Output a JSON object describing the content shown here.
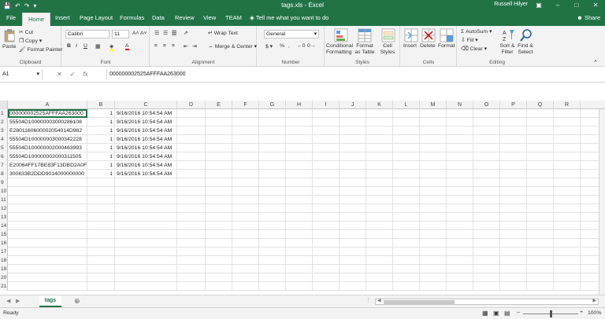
{
  "window": {
    "title": "tags.xls - Excel",
    "user": "Russell Hilyer"
  },
  "tabs": [
    "File",
    "Home",
    "Insert",
    "Page Layout",
    "Formulas",
    "Data",
    "Review",
    "View",
    "TEAM"
  ],
  "tell_me": "Tell me what you want to do",
  "share_label": "Share",
  "ribbon": {
    "clipboard": {
      "paste": "Paste",
      "cut": "Cut",
      "copy": "Copy",
      "format_painter": "Format Painter",
      "label": "Clipboard"
    },
    "font": {
      "name": "Calibri",
      "size": "11",
      "label": "Font"
    },
    "alignment": {
      "wrap_text": "Wrap Text",
      "merge_center": "Merge & Center",
      "label": "Alignment"
    },
    "number": {
      "format": "General",
      "label": "Number"
    },
    "styles": {
      "conditional": "Conditional Formatting",
      "format_table": "Format as Table",
      "cell_styles": "Cell Styles",
      "label": "Styles"
    },
    "cells": {
      "insert": "Insert",
      "delete": "Delete",
      "format": "Format",
      "label": "Cells"
    },
    "editing": {
      "autosum": "AutoSum",
      "fill": "Fill",
      "clear": "Clear",
      "sort_filter": "Sort & Filter",
      "find_select": "Find & Select",
      "label": "Editing"
    }
  },
  "formula_bar": {
    "name_box": "A1",
    "value": "000000002525AFFFAA263000"
  },
  "columns": [
    "A",
    "B",
    "C",
    "D",
    "E",
    "F",
    "G",
    "H",
    "I",
    "J",
    "K",
    "L",
    "M",
    "N",
    "O",
    "P",
    "Q",
    "R"
  ],
  "row_numbers": [
    "1",
    "2",
    "3",
    "4",
    "5",
    "6",
    "7",
    "8",
    "9",
    "10",
    "11",
    "12",
    "13",
    "14",
    "15",
    "16",
    "17",
    "18",
    "19",
    "20",
    "21"
  ],
  "data_rows": [
    [
      "000000002525AFFFAA263000",
      "1",
      "9/16/2016 10:54:54 AM"
    ],
    [
      "55504D100000003000286108",
      "1",
      "9/16/2016 10:54:54 AM"
    ],
    [
      "E2801160600002054014D982",
      "1",
      "9/16/2016 10:54:54 AM"
    ],
    [
      "55504D100000003000342228",
      "1",
      "9/16/2016 10:54:54 AM"
    ],
    [
      "55504D100000002000463993",
      "1",
      "9/16/2016 10:54:54 AM"
    ],
    [
      "55504D100000002000311505",
      "1",
      "9/16/2016 10:54:54 AM"
    ],
    [
      "E20064FF17BE83F13DBD2A0F",
      "1",
      "9/16/2016 10:54:54 AM"
    ],
    [
      "300833B2DDD9014000000000",
      "1",
      "9/16/2016 10:54:54 AM"
    ]
  ],
  "sheet_tab": "tags",
  "status": {
    "ready": "Ready",
    "zoom": "100%"
  },
  "colors": {
    "accent": "#217346"
  }
}
